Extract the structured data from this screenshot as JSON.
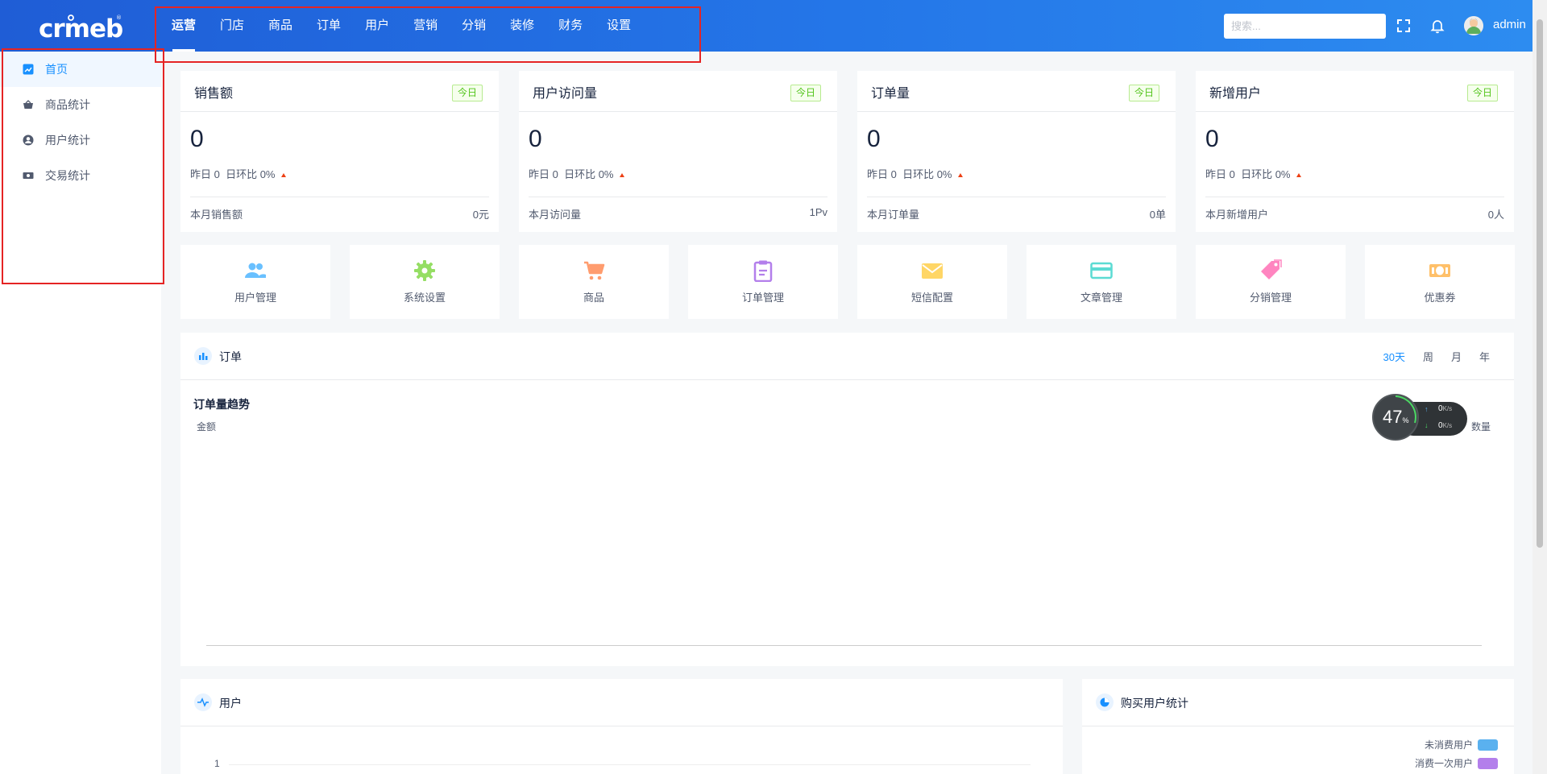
{
  "brand": {
    "logo_text": "crmeb",
    "accent": "#1890ff",
    "header_gradient": [
      "#1f5dd6",
      "#2d8cf0"
    ]
  },
  "topnav": {
    "items": [
      {
        "label": "运营",
        "active": true
      },
      {
        "label": "门店"
      },
      {
        "label": "商品"
      },
      {
        "label": "订单"
      },
      {
        "label": "用户"
      },
      {
        "label": "营销"
      },
      {
        "label": "分销"
      },
      {
        "label": "装修"
      },
      {
        "label": "财务"
      },
      {
        "label": "设置"
      }
    ]
  },
  "header": {
    "search_placeholder": "搜索...",
    "icons": [
      "fullscreen-icon",
      "bell-icon"
    ],
    "username": "admin"
  },
  "sidebar": {
    "items": [
      {
        "label": "首页",
        "icon": "chart-icon",
        "active": true
      },
      {
        "label": "商品统计",
        "icon": "basket-icon"
      },
      {
        "label": "用户统计",
        "icon": "user-circle-icon"
      },
      {
        "label": "交易统计",
        "icon": "money-icon"
      }
    ]
  },
  "stats": [
    {
      "title": "销售额",
      "tag": "今日",
      "value": "0",
      "yesterday": "昨日 0",
      "ratio": "日环比 0%",
      "month_label": "本月销售额",
      "month_value": "0元"
    },
    {
      "title": "用户访问量",
      "tag": "今日",
      "value": "0",
      "yesterday": "昨日 0",
      "ratio": "日环比 0%",
      "month_label": "本月访问量",
      "month_value": "1Pv"
    },
    {
      "title": "订单量",
      "tag": "今日",
      "value": "0",
      "yesterday": "昨日 0",
      "ratio": "日环比 0%",
      "month_label": "本月订单量",
      "month_value": "0单"
    },
    {
      "title": "新增用户",
      "tag": "今日",
      "value": "0",
      "yesterday": "昨日 0",
      "ratio": "日环比 0%",
      "month_label": "本月新增用户",
      "month_value": "0人"
    }
  ],
  "quick": [
    {
      "label": "用户管理",
      "icon": "users-icon",
      "color": "#69c0ff"
    },
    {
      "label": "系统设置",
      "icon": "gear-icon",
      "color": "#95de64"
    },
    {
      "label": "商品",
      "icon": "cart-icon",
      "color": "#ff9c6e"
    },
    {
      "label": "订单管理",
      "icon": "clipboard-icon",
      "color": "#b37feb"
    },
    {
      "label": "短信配置",
      "icon": "envelope-icon",
      "color": "#ffd666"
    },
    {
      "label": "文章管理",
      "icon": "card-icon",
      "color": "#5cdbd3"
    },
    {
      "label": "分销管理",
      "icon": "tag-icon",
      "color": "#ff85c0"
    },
    {
      "label": "优惠券",
      "icon": "coupon-icon",
      "color": "#ffc069"
    }
  ],
  "order_panel": {
    "title": "订单",
    "ranges": [
      {
        "label": "30天",
        "active": true
      },
      {
        "label": "周"
      },
      {
        "label": "月"
      },
      {
        "label": "年"
      }
    ],
    "chart_title": "订单量趋势",
    "left_axis": "金额",
    "right_axis": "数量"
  },
  "speed_widget": {
    "percent": "47",
    "unit": "%",
    "up": "0",
    "down": "0",
    "rate_unit": "K/s"
  },
  "user_panel": {
    "title": "用户",
    "y_tick": "1"
  },
  "buyer_panel": {
    "title": "购买用户统计",
    "legend": [
      {
        "label": "未消费用户",
        "color": "#5ab1ef"
      },
      {
        "label": "消费一次用户",
        "color": "#b37feb"
      }
    ]
  }
}
